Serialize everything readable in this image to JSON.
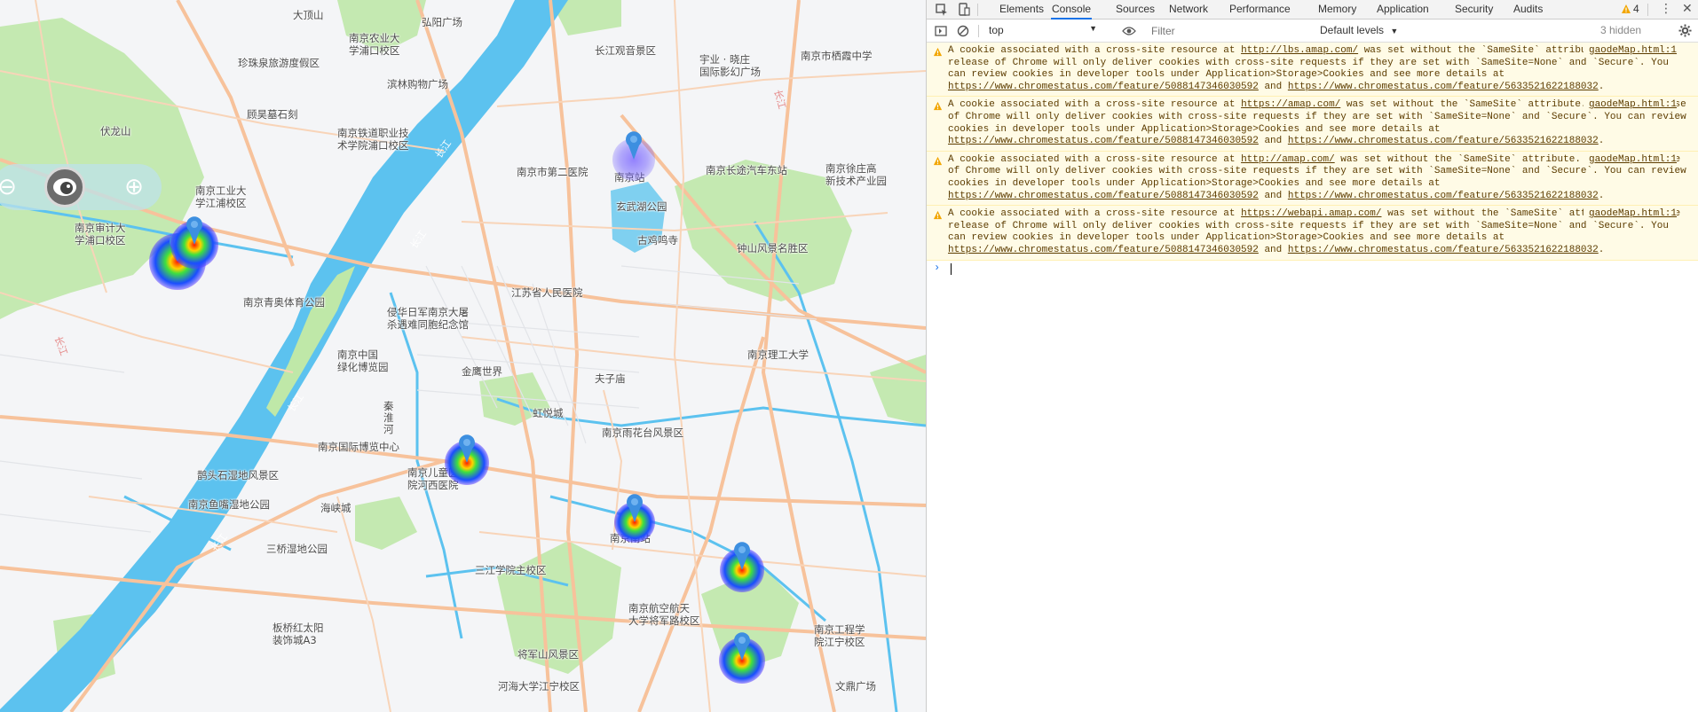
{
  "map": {
    "labels": [
      {
        "id": "lbl-datingshan",
        "text": "大顶山"
      },
      {
        "id": "lbl-hongyang",
        "text": "弘阳广场"
      },
      {
        "id": "lbl-nongye",
        "text": "南京农业大\n学浦口校区"
      },
      {
        "id": "lbl-changjiang",
        "text": "长江观音景区"
      },
      {
        "id": "lbl-yuye",
        "text": "宇业 · 晓庄\n国际影幻广场"
      },
      {
        "id": "lbl-qixia-school",
        "text": "南京市栖霞中学"
      },
      {
        "id": "lbl-zhenzhu",
        "text": "珍珠泉旅游度假区"
      },
      {
        "id": "lbl-binlin",
        "text": "滨林购物广场"
      },
      {
        "id": "lbl-dingfang",
        "text": "顾昊墓石刻"
      },
      {
        "id": "lbl-tielu",
        "text": "南京铁道职业技\n术学院浦口校区"
      },
      {
        "id": "lbl-fulongshan",
        "text": "伏龙山"
      },
      {
        "id": "lbl-dier",
        "text": "南京市第二医院"
      },
      {
        "id": "lbl-nanjingzhan",
        "text": "南京站"
      },
      {
        "id": "lbl-changtu",
        "text": "南京长途汽车东站"
      },
      {
        "id": "lbl-xuzhuang",
        "text": "南京徐庄高\n新技术产业园"
      },
      {
        "id": "lbl-gongye",
        "text": "南京工业大\n学江浦校区"
      },
      {
        "id": "lbl-xuanwuhu",
        "text": "玄武湖公园"
      },
      {
        "id": "lbl-jimingsi",
        "text": "古鸡鸣寺"
      },
      {
        "id": "lbl-zhongshan",
        "text": "钟山风景名胜区"
      },
      {
        "id": "lbl-shenji",
        "text": "南京审计大\n学浦口校区"
      },
      {
        "id": "lbl-jiangsu-hosp",
        "text": "江苏省人民医院"
      },
      {
        "id": "lbl-qingao",
        "text": "南京青奥体育公园"
      },
      {
        "id": "lbl-datusha",
        "text": "侵华日军南京大屠\n杀遇难同胞纪念馆"
      },
      {
        "id": "lbl-ligong",
        "text": "南京理工大学"
      },
      {
        "id": "lbl-lvhua",
        "text": "南京中国\n绿化博览园"
      },
      {
        "id": "lbl-jinying",
        "text": "金鹰世界"
      },
      {
        "id": "lbl-fuzimiao",
        "text": "夫子庙"
      },
      {
        "id": "lbl-hongyue",
        "text": "虹悦城"
      },
      {
        "id": "lbl-qinhuai-river",
        "text": "秦\n淮\n河"
      },
      {
        "id": "lbl-yuhuatai",
        "text": "南京雨花台风景区"
      },
      {
        "id": "lbl-guoji-expo",
        "text": "南京国际博览中心"
      },
      {
        "id": "lbl-ertong",
        "text": "南京儿童医\n院河西医院"
      },
      {
        "id": "lbl-queshi",
        "text": "鹊头石湿地风景区"
      },
      {
        "id": "lbl-yuzui",
        "text": "南京鱼嘴湿地公园"
      },
      {
        "id": "lbl-haixia",
        "text": "海峡城"
      },
      {
        "id": "lbl-nanzhan",
        "text": "南京南站"
      },
      {
        "id": "lbl-sanqiao",
        "text": "三桥湿地公园"
      },
      {
        "id": "lbl-sanjiang",
        "text": "三江学院主校区"
      },
      {
        "id": "lbl-hangkong",
        "text": "南京航空航天\n大学将军路校区"
      },
      {
        "id": "lbl-banqiao",
        "text": "板桥红太阳\n装饰城A3"
      },
      {
        "id": "lbl-gongcheng",
        "text": "南京工程学\n院江宁校区"
      },
      {
        "id": "lbl-jiangjunshan",
        "text": "将军山风景区"
      },
      {
        "id": "lbl-hehai",
        "text": "河海大学江宁校区"
      },
      {
        "id": "lbl-wending",
        "text": "文鼎广场"
      }
    ],
    "river_labels": [
      "长江",
      "长江",
      "长江",
      "长江",
      "长江",
      "长江"
    ],
    "markers": [
      {
        "id": "marker-pukou-1",
        "strength": "strong"
      },
      {
        "id": "marker-pukou-2",
        "strength": "strong"
      },
      {
        "id": "marker-nanjing-station",
        "strength": "weak"
      },
      {
        "id": "marker-hexi",
        "strength": "strong"
      },
      {
        "id": "marker-south-station",
        "strength": "strong"
      },
      {
        "id": "marker-east-south",
        "strength": "strong"
      },
      {
        "id": "marker-jiangning",
        "strength": "strong"
      }
    ],
    "zoom_out_symbol": "⊖",
    "zoom_in_symbol": "⊕"
  },
  "devtools": {
    "tabs": [
      "Elements",
      "Console",
      "Sources",
      "Network",
      "Performance",
      "Memory",
      "Application",
      "Security",
      "Audits"
    ],
    "active_tab": "Console",
    "warning_count": "4",
    "context": "top",
    "filter_placeholder": "Filter",
    "levels": "Default levels",
    "hidden": "3 hidden",
    "messages": [
      {
        "pre": "A cookie associated with a cross-site resource at ",
        "link": "http://lbs.amap.com/",
        "post": " was set without the `SameSite` attribute. A future release of Chrome will only deliver cookies with cross-site requests if they are set with `SameSite=None` and `Secure`. You can review cookies in developer tools under Application>Storage>Cookies and see more details at ",
        "link2": "https://www.chromestatus.com/feature/5088147346030592",
        "mid": " and ",
        "link3": "https://www.chromestatus.com/feature/5633521622188032",
        "end": ".",
        "source": "gaodeMap.html:1"
      },
      {
        "pre": "A cookie associated with a cross-site resource at ",
        "link": "https://amap.com/",
        "post": " was set without the `SameSite` attribute. A future release of Chrome will only deliver cookies with cross-site requests if they are set with `SameSite=None` and `Secure`. You can review cookies in developer tools under Application>Storage>Cookies and see more details at ",
        "link2": "https://www.chromestatus.com/feature/5088147346030592",
        "mid": " and ",
        "link3": "https://www.chromestatus.com/feature/5633521622188032",
        "end": ".",
        "source": "gaodeMap.html:1"
      },
      {
        "pre": "A cookie associated with a cross-site resource at ",
        "link": "http://amap.com/",
        "post": " was set without the `SameSite` attribute. A future release of Chrome will only deliver cookies with cross-site requests if they are set with `SameSite=None` and `Secure`. You can review cookies in developer tools under Application>Storage>Cookies and see more details at ",
        "link2": "https://www.chromestatus.com/feature/5088147346030592",
        "mid": " and ",
        "link3": "https://www.chromestatus.com/feature/5633521622188032",
        "end": ".",
        "source": "gaodeMap.html:1"
      },
      {
        "pre": "A cookie associated with a cross-site resource at ",
        "link": "https://webapi.amap.com/",
        "post": " was set without the `SameSite` attribute. A future release of Chrome will only deliver cookies with cross-site requests if they are set with `SameSite=None` and `Secure`. You can review cookies in developer tools under Application>Storage>Cookies and see more details at ",
        "link2": "https://www.chromestatus.com/feature/5088147346030592",
        "mid": " and ",
        "link3": "https://www.chromestatus.com/feature/5633521622188032",
        "end": ".",
        "source": "gaodeMap.html:1"
      }
    ],
    "prompt_symbol": "›"
  }
}
